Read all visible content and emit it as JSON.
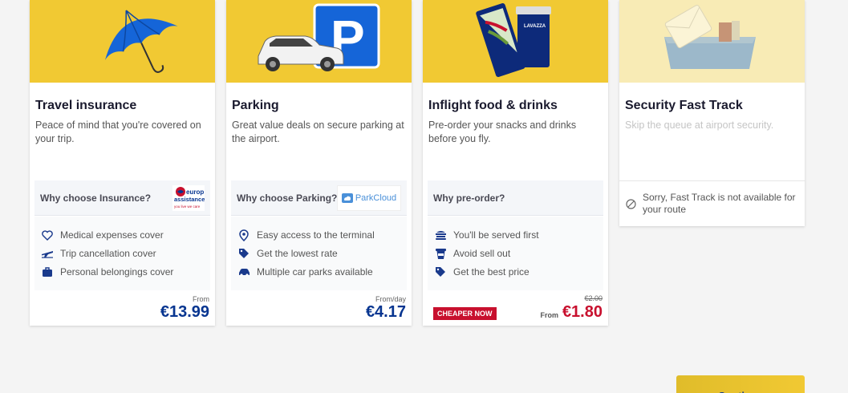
{
  "cards": [
    {
      "title": "Travel insurance",
      "description": "Peace of mind that you're covered on your trip.",
      "image_icon": "umbrella-icon",
      "why_label": "Why choose Insurance?",
      "partner": {
        "logo_lines": [
          "europ",
          "assistance"
        ],
        "tagline": "you live we care",
        "logo_icon": "europ-assistance-logo"
      },
      "benefits": [
        {
          "icon": "heart-icon",
          "label": "Medical expenses cover"
        },
        {
          "icon": "plane-icon",
          "label": "Trip cancellation cover"
        },
        {
          "icon": "bag-icon",
          "label": "Personal belongings cover"
        }
      ],
      "price_prefix": "From",
      "price": "€13.99"
    },
    {
      "title": "Parking",
      "description": "Great value deals on secure parking at the airport.",
      "image_icon": "parking-car-icon",
      "why_label": "Why choose Parking?",
      "partner": {
        "logo_text": "ParkCloud",
        "logo_icon": "parkcloud-logo"
      },
      "benefits": [
        {
          "icon": "location-pin-icon",
          "label": "Easy access to the terminal"
        },
        {
          "icon": "tag-icon",
          "label": "Get the lowest rate"
        },
        {
          "icon": "car-icon",
          "label": "Multiple car parks available"
        }
      ],
      "price_prefix": "From/day",
      "price": "€4.17"
    },
    {
      "title": "Inflight food & drinks",
      "description": "Pre-order your snacks and drinks before you fly.",
      "image_icon": "sandwich-coffee-icon",
      "partner": {
        "logo_text": "LAVAZZA"
      },
      "why_label": "Why pre-order?",
      "benefits": [
        {
          "icon": "food-icon",
          "label": "You'll be served first"
        },
        {
          "icon": "cup-icon",
          "label": "Avoid sell out"
        },
        {
          "icon": "tag-icon",
          "label": "Get the best price"
        }
      ],
      "badge": "CHEAPER NOW",
      "old_price": "€2.00",
      "price_prefix": "From",
      "price": "€1.80"
    },
    {
      "title": "Security Fast Track",
      "description": "Skip the queue at airport security.",
      "image_icon": "security-tray-icon",
      "unavailable_text": "Sorry, Fast Track is not available for your route",
      "unavailable_icon": "blocked-icon"
    }
  ],
  "continue_label": "Continue",
  "colors": {
    "accent": "#f1c933",
    "brand": "#073590",
    "sale": "#c8102e"
  }
}
